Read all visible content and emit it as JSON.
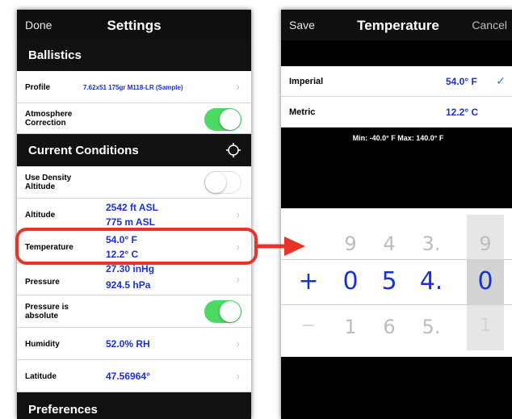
{
  "settings": {
    "nav": {
      "done_label": "Done",
      "title": "Settings"
    },
    "sections": {
      "ballistics": "Ballistics",
      "current_conditions": "Current Conditions",
      "preferences": "Preferences"
    },
    "rows": {
      "profile": {
        "label": "Profile",
        "value": "7.62x51 175gr M118-LR (Sample)"
      },
      "atmosphere": {
        "label_line1": "Atmosphere",
        "label_line2": "Correction",
        "on": true
      },
      "density": {
        "label_line1": "Use Density",
        "label_line2": "Altitude",
        "on": false
      },
      "altitude": {
        "label": "Altitude",
        "value1": "2542 ft ASL",
        "value2": "775 m ASL"
      },
      "temperature": {
        "label": "Temperature",
        "value1": "54.0° F",
        "value2": "12.2° C"
      },
      "pressure": {
        "label": "Pressure",
        "value1": "27.30 inHg",
        "value2": "924.5 hPa"
      },
      "pressure_absolute": {
        "label_line1": "Pressure is",
        "label_line2": "absolute",
        "on": true
      },
      "humidity": {
        "label": "Humidity",
        "value": "52.0% RH"
      },
      "latitude": {
        "label": "Latitude",
        "value": "47.56964°"
      }
    }
  },
  "temperature_page": {
    "nav": {
      "save_label": "Save",
      "title": "Temperature",
      "cancel_label": "Cancel"
    },
    "imperial": {
      "label": "Imperial",
      "value": "54.0° F",
      "check": "✓"
    },
    "metric": {
      "label": "Metric",
      "value": "12.2° C"
    },
    "range_text": "Min: -40.0° F   Max: 140.0° F",
    "picker": {
      "above": [
        "",
        "9",
        "4",
        "3.",
        "9"
      ],
      "selected": [
        "+",
        "0",
        "5",
        "4.",
        "0"
      ],
      "below": [
        "−",
        "1",
        "6",
        "5.",
        "1"
      ]
    }
  },
  "colors": {
    "value_blue": "#1a2fd6",
    "toggle_green": "#4cd964",
    "highlight_red": "#e8332a"
  },
  "icons": {
    "location": "crosshair-icon",
    "chevron": "chevron-right-icon"
  }
}
